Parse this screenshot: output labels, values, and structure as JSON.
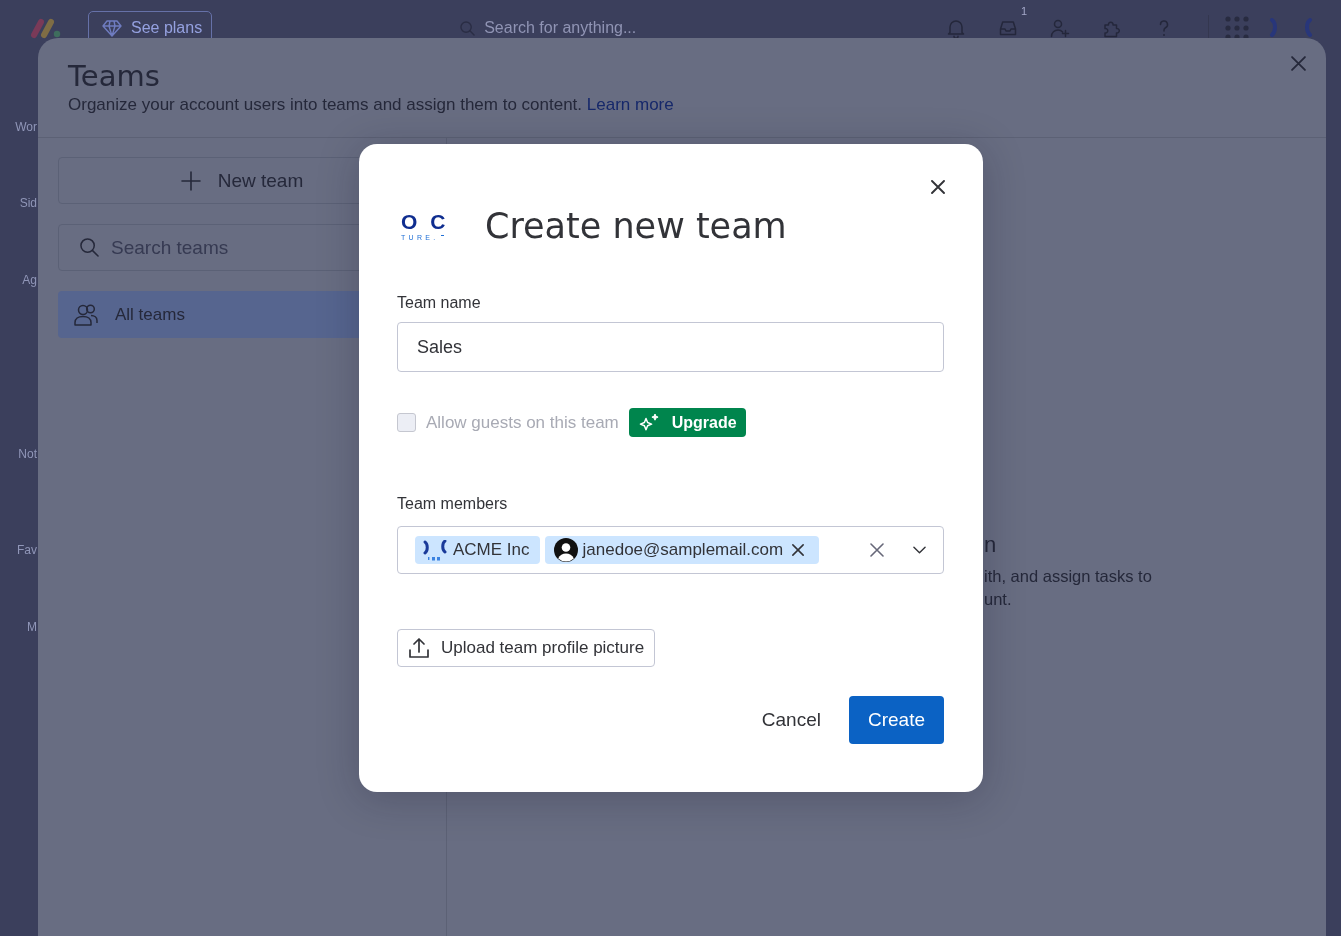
{
  "top_bar": {
    "plans_button": "See plans",
    "search": {
      "placeholder": "Search for anything..."
    },
    "inbox_badge": "1"
  },
  "sidebar": {
    "items": [
      {
        "label": "Wor"
      },
      {
        "label": "Sid"
      },
      {
        "label": "Ag"
      },
      {
        "label": "Not"
      },
      {
        "label": "Fav"
      },
      {
        "label": "M"
      }
    ]
  },
  "teams_panel": {
    "title": "Teams",
    "subtitle": "Organize your account users into teams and assign them to content.",
    "learn_more_link": "Learn more",
    "new_team_button": "New team",
    "search": {
      "placeholder": "Search teams"
    },
    "team_list": [
      {
        "label": "All teams",
        "selected": true
      }
    ],
    "empty_state": {
      "heading": "n",
      "text_lines": [
        "ith, and assign tasks to",
        "unt."
      ]
    }
  },
  "dialog": {
    "logo": {
      "text": "O C",
      "subtext": "TURE."
    },
    "title": "Create new team",
    "team_name": {
      "label": "Team name",
      "value": "Sales"
    },
    "guests": {
      "label": "Allow guests on this team",
      "checked": false,
      "disabled": true,
      "upgrade_button": "Upgrade"
    },
    "members": {
      "label": "Team members",
      "chips": [
        {
          "kind": "company",
          "label": "ACME Inc",
          "removable": false
        },
        {
          "kind": "user",
          "label": "janedoe@samplemail.com",
          "removable": true
        }
      ]
    },
    "upload_button": "Upload team profile picture",
    "buttons": [
      {
        "kind": "secondary",
        "label": "Cancel"
      },
      {
        "kind": "primary",
        "label": "Create"
      }
    ]
  }
}
